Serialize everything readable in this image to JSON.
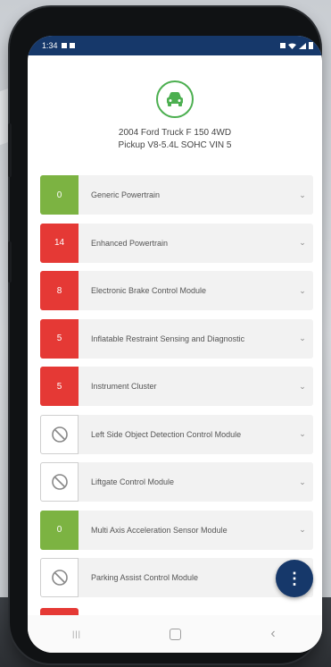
{
  "status_bar": {
    "time": "1:34"
  },
  "vehicle": {
    "line1": "2004 Ford Truck F 150 4WD",
    "line2": "Pickup V8-5.4L SOHC VIN 5"
  },
  "modules": [
    {
      "count": "0",
      "status": "green",
      "name": "Generic Powertrain"
    },
    {
      "count": "14",
      "status": "red",
      "name": "Enhanced Powertrain"
    },
    {
      "count": "8",
      "status": "red",
      "name": "Electronic Brake Control Module"
    },
    {
      "count": "5",
      "status": "red",
      "name": "Inflatable Restraint Sensing and Diagnostic"
    },
    {
      "count": "5",
      "status": "red",
      "name": "Instrument Cluster"
    },
    {
      "count": "",
      "status": "none",
      "name": "Left Side Object Detection Control Module"
    },
    {
      "count": "",
      "status": "none",
      "name": "Liftgate Control Module"
    },
    {
      "count": "0",
      "status": "green",
      "name": "Multi Axis Acceleration Sensor Module"
    },
    {
      "count": "",
      "status": "none",
      "name": "Parking Assist Control Module"
    }
  ],
  "colors": {
    "primary": "#16386a",
    "ok": "#7cb342",
    "error": "#e53935"
  },
  "fab": {
    "icon": "more-vertical-icon",
    "glyph": "⋮"
  },
  "nav": {
    "recents_icon": "recents-icon",
    "recents_glyph": "|||",
    "home_icon": "home-icon",
    "back_icon": "back-icon",
    "back_glyph": "‹"
  }
}
